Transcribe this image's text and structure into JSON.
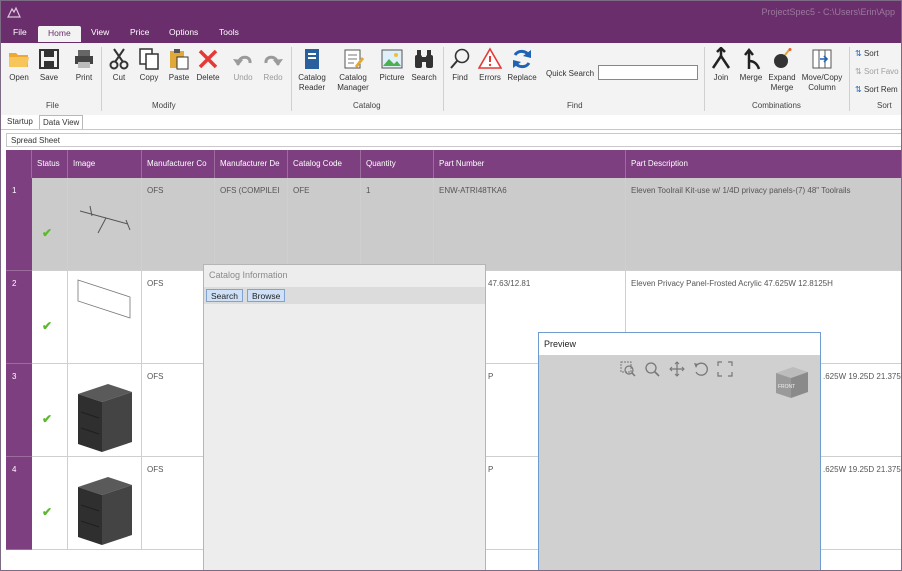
{
  "window": {
    "title": "ProjectSpec5 - C:\\Users\\Erin\\App"
  },
  "menu": [
    "File",
    "Home",
    "View",
    "Price",
    "Options",
    "Tools"
  ],
  "ribbon": {
    "file_buttons": [
      "Open",
      "Save",
      "Print"
    ],
    "file_group": "File",
    "modify_buttons": [
      "Cut",
      "Copy",
      "Paste",
      "Delete",
      "Undo",
      "Redo"
    ],
    "modify_group": "Modify",
    "catalog_buttons": [
      "Catalog Reader",
      "Catalog Manager",
      "Picture",
      "Search"
    ],
    "catalog_group": "Catalog",
    "find_buttons": [
      "Find",
      "Errors",
      "Replace"
    ],
    "quick_search_label": "Quick Search",
    "quick_search_value": "",
    "find_group": "Find",
    "combination_buttons": [
      "Join",
      "Merge",
      "Expand Merge",
      "Move/Copy Column"
    ],
    "combinations_group": "Combinations",
    "sort_items": [
      "Sort",
      "Sort Favo",
      "Sort Rem"
    ],
    "sort_group": "Sort"
  },
  "page_tabs": [
    "Startup",
    "Data View"
  ],
  "spreadsheet_label": "Spread Sheet",
  "columns": [
    "Status",
    "Image",
    "Manufacturer Co",
    "Manufacturer De",
    "Catalog Code",
    "Quantity",
    "Part Number",
    "Part Description"
  ],
  "rows": [
    {
      "num": "1",
      "status": "✔",
      "manufacturer_code": "OFS",
      "manufacturer_desc": "OFS (COMPILEI",
      "catalog_code": "OFE",
      "quantity": "1",
      "part_number": "ENW-ATRI48TKA6",
      "part_description": "Eleven Toolrail Kit-use w/ 1/4D privacy panels-(7) 48\" Toolrails"
    },
    {
      "num": "2",
      "status": "✔",
      "manufacturer_code": "OFS",
      "manufacturer_desc": "",
      "catalog_code": "",
      "quantity": "",
      "part_number": "47.63/12.81",
      "part_description": "Eleven Privacy Panel-Frosted Acrylic 47.625W 12.8125H"
    },
    {
      "num": "3",
      "status": "✔",
      "manufacturer_code": "OFS",
      "manufacturer_desc": "",
      "catalog_code": "",
      "quantity": "",
      "part_number": "P",
      "part_description": ".625W 19.25D 21.375"
    },
    {
      "num": "4",
      "status": "✔",
      "manufacturer_code": "OFS",
      "manufacturer_desc": "",
      "catalog_code": "",
      "quantity": "",
      "part_number": "P",
      "part_description": ".625W 19.25D 21.375"
    }
  ],
  "catalog_info": {
    "title": "Catalog Information",
    "search_button": "Search",
    "browse_button": "Browse"
  },
  "preview": {
    "title": "Preview",
    "cube_label": "FRONT"
  },
  "colors": {
    "accent": "#6a2e6c",
    "header": "#7d3f80",
    "check": "#5cb82e"
  }
}
